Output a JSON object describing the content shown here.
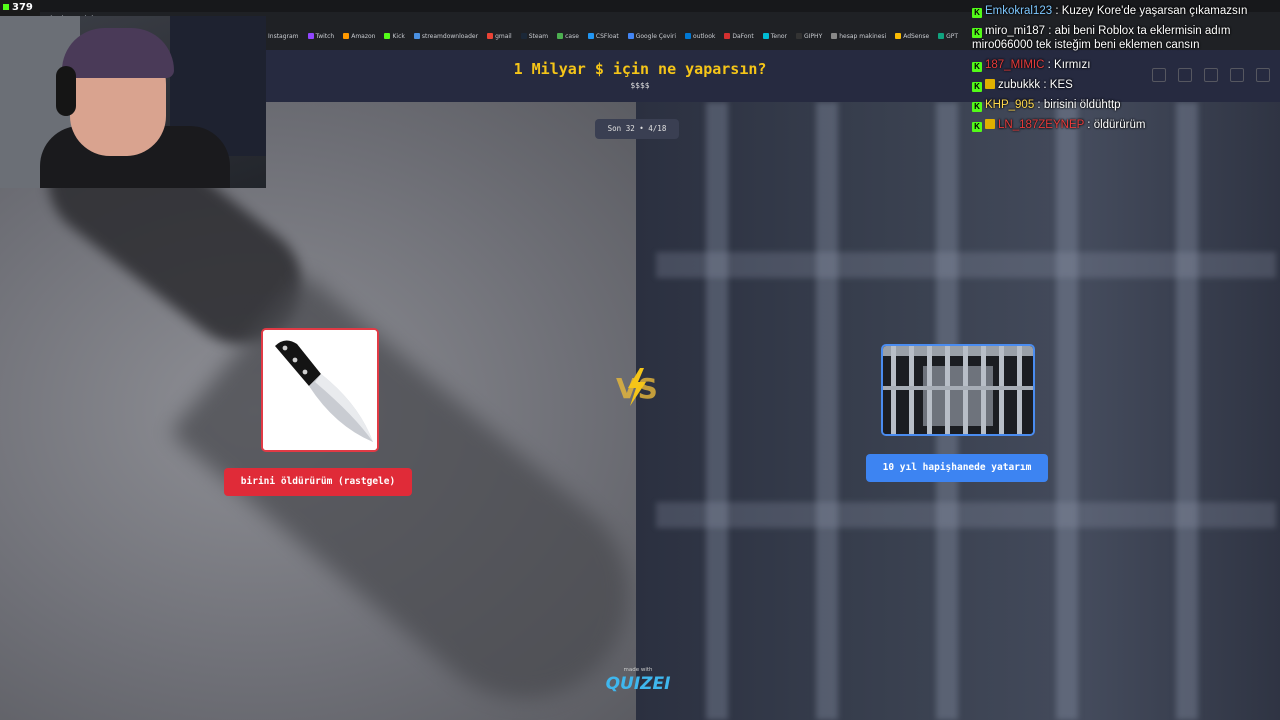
{
  "stream": {
    "viewer_count": "379"
  },
  "browser": {
    "url": "quizei.com/play",
    "bookmarks": [
      "Instagram",
      "Twitch",
      "Amazon",
      "Kick",
      "streamdownloader",
      "gmail",
      "Steam",
      "case",
      "CSFloat",
      "Google Çeviri",
      "outlook",
      "DaFont",
      "Tenor",
      "GIPHY",
      "hesap makinesi",
      "AdSense",
      "GPT"
    ]
  },
  "game": {
    "title": "1 Milyar $ için ne yaparsın?",
    "subtitle": "$$$$",
    "round": "Son 32 • 4/18",
    "left_choice": {
      "label": "birini öldürürüm (rastgele)",
      "image_icon": "knife-icon",
      "color": "#e02b38"
    },
    "right_choice": {
      "label": "10 yıl hapişhanede yatarım",
      "image_icon": "jail-cell-icon",
      "color": "#3d84f2"
    },
    "vs_icon": "vs-lightning-icon",
    "made_with": "made with",
    "brand": "QUIZEI"
  },
  "chat": [
    {
      "user": "Emkokral123",
      "user_color": "#7ec8ff",
      "text": "Kuzey Kore'de yaşarsan çıkamazsın",
      "badge": false
    },
    {
      "user": "miro_mi187",
      "user_color": "#ffffff",
      "text": "abi beni Roblox ta eklermisin adım miro066000 tek isteğim beni eklemen cansın",
      "badge": false
    },
    {
      "user": "187_MIMIC",
      "user_color": "#e63b3b",
      "text": "Kırmızı",
      "badge": false
    },
    {
      "user": "zubukkk",
      "user_color": "#ffffff",
      "text": "KES",
      "badge": true
    },
    {
      "user": "KHP_905",
      "user_color": "#ffd84d",
      "text": "birisini öldühttp",
      "badge": false
    },
    {
      "user": "LN_187ZEYNEP",
      "user_color": "#e63b3b",
      "text": "öldürürüm",
      "badge": true
    }
  ]
}
